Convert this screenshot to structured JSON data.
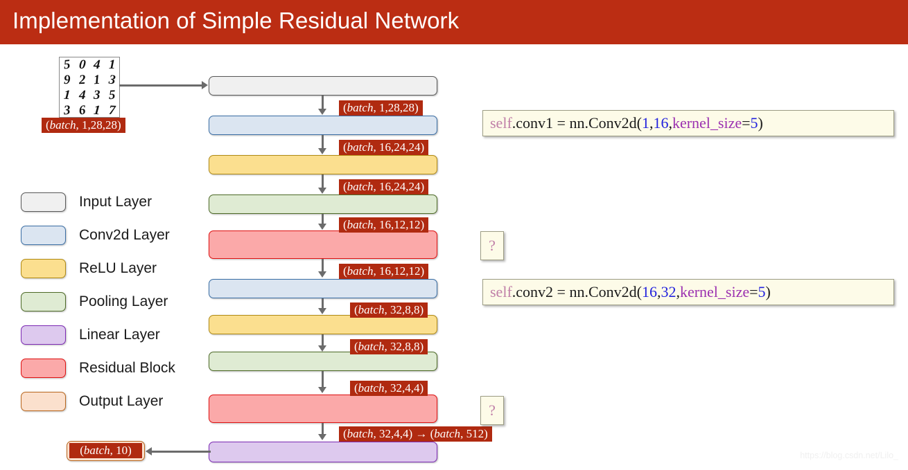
{
  "slide": {
    "title": "Implementation of Simple Residual Network",
    "title_bar_color": "#bb2d13",
    "background_color": "#ffffff",
    "watermark": "https://blog.csdn.net/Lilo_"
  },
  "input_image": {
    "caption": "(batch, 1,28,28)",
    "digits": [
      "5",
      "0",
      "4",
      "1",
      "9",
      "2",
      "1",
      "3",
      "1",
      "4",
      "3",
      "5",
      "3",
      "6",
      "1",
      "7"
    ]
  },
  "legend": {
    "items": [
      {
        "label": "Input Layer",
        "fill": "#f0f0f0",
        "stroke": "#595959"
      },
      {
        "label": "Conv2d Layer",
        "fill": "#dbe5f1",
        "stroke": "#3a6ea5"
      },
      {
        "label": "ReLU Layer",
        "fill": "#fbdf8f",
        "stroke": "#b08a14"
      },
      {
        "label": "Pooling Layer",
        "fill": "#dfebd3",
        "stroke": "#4e6b28"
      },
      {
        "label": "Linear Layer",
        "fill": "#ddc9ee",
        "stroke": "#7d2ab5"
      },
      {
        "label": "Residual Block",
        "fill": "#fba9a9",
        "stroke": "#e01010"
      },
      {
        "label": "Output Layer",
        "fill": "#fbe0cd",
        "stroke": "#b9671e"
      }
    ]
  },
  "network": {
    "layers": [
      {
        "type": "Input Layer",
        "name": "input"
      },
      {
        "type": "Conv2d Layer",
        "name": "conv1"
      },
      {
        "type": "ReLU Layer",
        "name": "relu1"
      },
      {
        "type": "Pooling Layer",
        "name": "pool1"
      },
      {
        "type": "Residual Block",
        "name": "resblock1"
      },
      {
        "type": "Conv2d Layer",
        "name": "conv2"
      },
      {
        "type": "ReLU Layer",
        "name": "relu2"
      },
      {
        "type": "Pooling Layer",
        "name": "pool2"
      },
      {
        "type": "Residual Block",
        "name": "resblock2"
      },
      {
        "type": "Linear Layer",
        "name": "fc"
      }
    ],
    "shape_labels": [
      "(batch, 1,28,28)",
      "(batch, 16,24,24)",
      "(batch, 16,24,24)",
      "(batch, 16,12,12)",
      "(batch, 16,12,12)",
      "(batch, 32,8,8)",
      "(batch, 32,8,8)",
      "(batch, 32,4,4)",
      "(batch, 32,4,4) → (batch, 512)"
    ],
    "output_label": "(batch, 10)"
  },
  "code": {
    "conv1": {
      "tokens": [
        {
          "text": "self",
          "kind": "self"
        },
        {
          "text": ".conv1 = nn.Conv2d(",
          "kind": "plain"
        },
        {
          "text": "1",
          "kind": "num"
        },
        {
          "text": ",  ",
          "kind": "plain"
        },
        {
          "text": "16",
          "kind": "num"
        },
        {
          "text": ",  ",
          "kind": "plain"
        },
        {
          "text": "kernel_size",
          "kind": "kw"
        },
        {
          "text": "=",
          "kind": "plain"
        },
        {
          "text": "5",
          "kind": "num"
        },
        {
          "text": ")",
          "kind": "plain"
        }
      ],
      "plain_text": "self.conv1 = nn.Conv2d(1,  16,  kernel_size=5)"
    },
    "conv2": {
      "tokens": [
        {
          "text": "self",
          "kind": "self"
        },
        {
          "text": ".conv2 = nn.Conv2d(",
          "kind": "plain"
        },
        {
          "text": "16",
          "kind": "num"
        },
        {
          "text": ",  ",
          "kind": "plain"
        },
        {
          "text": "32",
          "kind": "num"
        },
        {
          "text": ",  ",
          "kind": "plain"
        },
        {
          "text": "kernel_size",
          "kind": "kw"
        },
        {
          "text": "=",
          "kind": "plain"
        },
        {
          "text": "5",
          "kind": "num"
        },
        {
          "text": ")",
          "kind": "plain"
        }
      ],
      "plain_text": "self.conv2 = nn.Conv2d(16,  32,  kernel_size=5)"
    },
    "question_1": "?",
    "question_2": "?"
  }
}
